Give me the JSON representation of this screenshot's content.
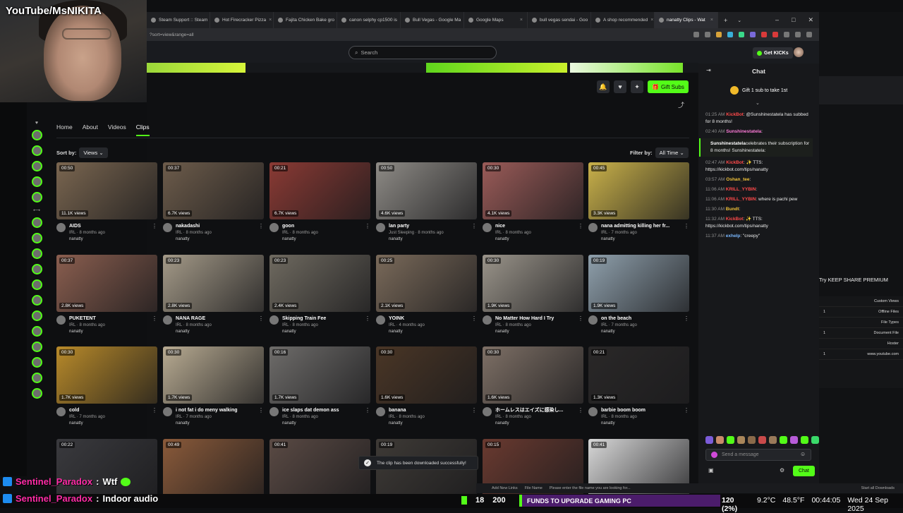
{
  "overlay": {
    "channel_tag": "YouTube/MsNIKITA",
    "chat_lines": [
      {
        "user": "Sentinel_Paradox",
        "sep": ":",
        "text": "Wtf"
      },
      {
        "user": "Sentinel_Paradox",
        "sep": ":",
        "text": "Indoor audio"
      }
    ],
    "viewer_count": "18",
    "sub_count": "200",
    "goal_text": "FUNDS TO UPGRADE GAMING PC",
    "fps_stat": "120 (2%)",
    "temp": "9.2°C",
    "humidity": "48.5°F",
    "clock": "00:44:05",
    "date": "Wed 24 Sep 2025"
  },
  "browser": {
    "tabs": [
      {
        "label": "Steam Support :: Steam"
      },
      {
        "label": "Hot Firecracker Pizza"
      },
      {
        "label": "Fajita Chicken Bake gro"
      },
      {
        "label": "canon selphy cp1500 is"
      },
      {
        "label": "Bull Vegas - Google Ma"
      },
      {
        "label": "Google Maps"
      },
      {
        "label": "bull vegas sendai - Goo"
      },
      {
        "label": "A shop recommended"
      },
      {
        "label": "nanatty Clips - Wat"
      }
    ],
    "address": "?sort=view&range=all",
    "window_controls": [
      "–",
      "□",
      "✕"
    ]
  },
  "kick": {
    "search_placeholder": "Search",
    "get_kicks_label": "Get KICKs",
    "gift_subs_label": "Gift Subs",
    "channel_tabs": [
      "Home",
      "About",
      "Videos",
      "Clips"
    ],
    "sort_label": "Sort by:",
    "sort_value": "Views",
    "filter_label": "Filter by:",
    "filter_value": "All Time",
    "channel_name": "nanatty",
    "clips": [
      {
        "title": "AIDS",
        "category": "IRL",
        "ago": "8 months ago",
        "duration": "00:50",
        "views": "11.1K views",
        "tone": "#7a6650"
      },
      {
        "title": "nakadashi",
        "category": "IRL",
        "ago": "8 months ago",
        "duration": "00:37",
        "views": "6.7K views",
        "tone": "#6d5c4b"
      },
      {
        "title": "goon",
        "category": "IRL",
        "ago": "8 months ago",
        "duration": "00:21",
        "views": "6.7K views",
        "tone": "#8a3a34"
      },
      {
        "title": "lan party",
        "category": "Just Sleeping",
        "ago": "8 months ago",
        "duration": "00:50",
        "views": "4.6K views",
        "tone": "#8e8b86"
      },
      {
        "title": "nice",
        "category": "IRL",
        "ago": "8 months ago",
        "duration": "00:30",
        "views": "4.1K views",
        "tone": "#9a5b58"
      },
      {
        "title": "nana admitting killing her fr...",
        "category": "IRL",
        "ago": "7 months ago",
        "duration": "00:45",
        "views": "3.3K views",
        "tone": "#c9b14a"
      },
      {
        "title": "PUKETENT",
        "category": "IRL",
        "ago": "8 months ago",
        "duration": "00:37",
        "views": "2.8K views",
        "tone": "#8a5e4f"
      },
      {
        "title": "NANA RAGE",
        "category": "IRL",
        "ago": "8 months ago",
        "duration": "00:23",
        "views": "2.8K views",
        "tone": "#a49a88"
      },
      {
        "title": "Skipping Train Fee",
        "category": "IRL",
        "ago": "8 months ago",
        "duration": "00:23",
        "views": "2.4K views",
        "tone": "#6f6a60"
      },
      {
        "title": "YOINK",
        "category": "IRL",
        "ago": "4 months ago",
        "duration": "00:25",
        "views": "2.1K views",
        "tone": "#7a6a5a"
      },
      {
        "title": "No Matter How Hard I Try",
        "category": "IRL",
        "ago": "8 months ago",
        "duration": "00:30",
        "views": "1.9K views",
        "tone": "#9a948a"
      },
      {
        "title": "on the beach",
        "category": "IRL",
        "ago": "7 months ago",
        "duration": "00:19",
        "views": "1.9K views",
        "tone": "#8fa0ac"
      },
      {
        "title": "cold",
        "category": "IRL",
        "ago": "7 months ago",
        "duration": "00:30",
        "views": "1.7K views",
        "tone": "#b88a2a"
      },
      {
        "title": "i not fat i do meny walking",
        "category": "IRL",
        "ago": "7 months ago",
        "duration": "00:30",
        "views": "1.7K views",
        "tone": "#b8ab92"
      },
      {
        "title": "ice slaps dat demon ass",
        "category": "IRL",
        "ago": "8 months ago",
        "duration": "00:16",
        "views": "1.7K views",
        "tone": "#6e6c6a"
      },
      {
        "title": "banana",
        "category": "IRL",
        "ago": "8 months ago",
        "duration": "00:30",
        "views": "1.6K views",
        "tone": "#4a3626"
      },
      {
        "title": "ホームレスはエイズに感染し...",
        "category": "IRL",
        "ago": "8 months ago",
        "duration": "00:30",
        "views": "1.6K views",
        "tone": "#7e7066"
      },
      {
        "title": "barbie boom boom",
        "category": "IRL",
        "ago": "8 months ago",
        "duration": "00:21",
        "views": "1.3K views",
        "tone": "#2a2828"
      },
      {
        "title": "",
        "category": "",
        "ago": "",
        "duration": "00:22",
        "views": "",
        "tone": "#3a3a3e"
      },
      {
        "title": "",
        "category": "",
        "ago": "",
        "duration": "00:49",
        "views": "",
        "tone": "#8a5a3a"
      },
      {
        "title": "",
        "category": "",
        "ago": "",
        "duration": "00:41",
        "views": "",
        "tone": "#5a4a44"
      },
      {
        "title": "",
        "category": "",
        "ago": "",
        "duration": "00:19",
        "views": "",
        "tone": "#3e3a36"
      },
      {
        "title": "",
        "category": "",
        "ago": "",
        "duration": "00:15",
        "views": "",
        "tone": "#6a3a30"
      },
      {
        "title": "",
        "category": "",
        "ago": "",
        "duration": "00:41",
        "views": "",
        "tone": "#d8d8d8"
      }
    ],
    "toast": "The clip has been downloaded successfully!"
  },
  "chat": {
    "header": "Chat",
    "gift_cta": "Gift 1 sub to take 1st",
    "messages": [
      {
        "time": "01:25 AM",
        "user": "KickBot",
        "user_color": "#ff4a4a",
        "text": ": @Sunshinestatela has subbed for 8 months!"
      },
      {
        "time": "02:40 AM",
        "user": "Sunshinestatela",
        "user_color": "#ff7bd9",
        "text": ":"
      },
      {
        "time": "",
        "user": "Sunshinestatela",
        "user_color": "#ffffff",
        "text": "celebrates their subscription for 8 months! Sunshinestatela:",
        "event": true
      },
      {
        "time": "02:47 AM",
        "user": "KickBot",
        "user_color": "#ff4a4a",
        "text": ": ✨ TTS: https://kickbot.com/tips/nanatty"
      },
      {
        "time": "03:57 AM",
        "user": "Oshan_tee",
        "user_color": "#f0c23a",
        "text": ":"
      },
      {
        "time": "11:06 AM",
        "user": "KRILL_YYBIN",
        "user_color": "#ff4a4a",
        "text": ":"
      },
      {
        "time": "11:06 AM",
        "user": "KRILL_YYBIN",
        "user_color": "#ff4a4a",
        "text": ": where is pachi pew"
      },
      {
        "time": "11:30 AM",
        "user": "Bundt",
        "user_color": "#f0c23a",
        "text": ":"
      },
      {
        "time": "11:32 AM",
        "user": "KickBot",
        "user_color": "#ff4a4a",
        "text": ": ✨ TTS: https://kickbot.com/tips/nanatty"
      },
      {
        "time": "11:37 AM",
        "user": "exhelp",
        "user_color": "#7ab8ff",
        "text": ": \"creepy\""
      }
    ],
    "input_placeholder": "Send a message",
    "send_label": "Chat"
  },
  "desktop": {
    "keep_share": "Try KEEP SHARE PREMIUM",
    "panel_rows": [
      {
        "label": "Custom Views",
        "value": ""
      },
      {
        "label": "Offline Files",
        "value": "1"
      },
      {
        "label": "File Types",
        "value": ""
      },
      {
        "label": "Document File",
        "value": "1"
      },
      {
        "label": "Hoster",
        "value": ""
      },
      {
        "label": "www.youtube.com",
        "value": "1"
      }
    ],
    "tray_items": [
      "Add New Links",
      "File Name",
      "Please enter the file name you are looking for...",
      "Start all Downloads"
    ]
  },
  "colors": {
    "accent": "#53fc18",
    "page_bg": "#0f1012",
    "chat_bg": "#17181b",
    "goal_bg": "#4b1c6b",
    "chatter_name": "#ff2ba6"
  }
}
